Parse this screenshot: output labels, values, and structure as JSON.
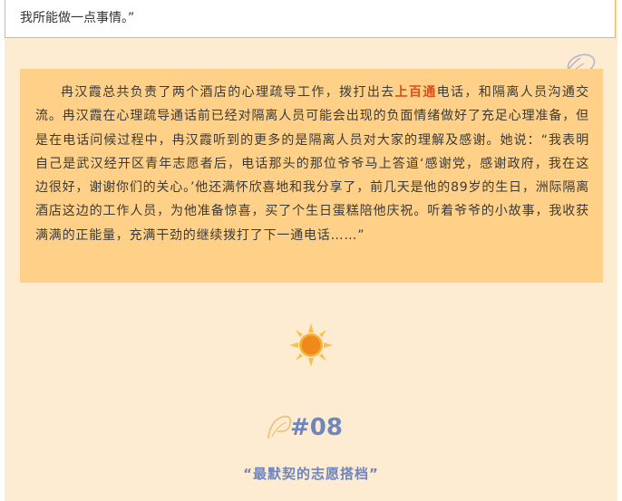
{
  "top_quote": {
    "text": "我所能做一点事情。”"
  },
  "story": {
    "before_highlight": "冉汉霞总共负责了两个酒店的心理疏导工作，拨打出去",
    "highlight": "上百通",
    "after_highlight": "电话，和隔离人员沟通交流。冉汉霞在心理疏导通话前已经对隔离人员可能会出现的负面情绪做好了充足心理准备，但是在电话问候过程中，冉汉霞听到的更多的是隔离人员对大家的理解及感谢。她说：“我表明自己是武汉经开区青年志愿者后，电话那头的那位爷爷马上答道‘感谢党，感谢政府，我在这边很好，谢谢你们的关心。’他还满怀欣喜地和我分享了，前几天是他的89岁的生日，洲际隔离酒店这边的工作人员，为他准备惊喜，买了个生日蛋糕陪他庆祝。听着爷爷的小故事，我收获满满的正能量，充满干劲的继续拨打了下一通电话……”"
  },
  "section": {
    "number": "#08",
    "title": "“最默契的志愿搭档”"
  },
  "colors": {
    "background": "#fdecd2",
    "card": "#ffd188",
    "highlight": "#e04c1a",
    "accent_blue": "#6e86bd",
    "sun": "#f39a1e"
  },
  "icons": [
    "swirl-icon",
    "sun-icon"
  ]
}
